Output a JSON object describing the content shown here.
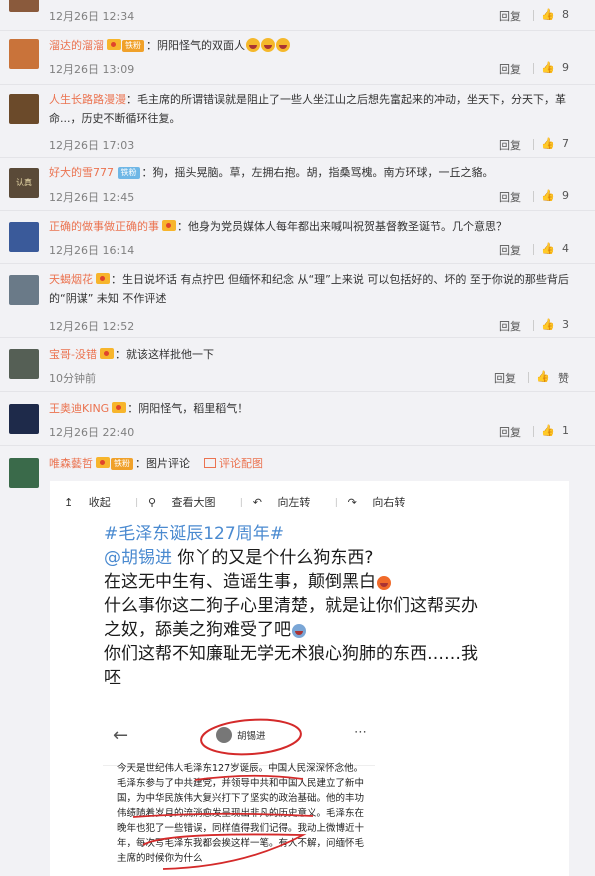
{
  "reply_label": "回复",
  "like_label": "赞",
  "comments": [
    {
      "user": "",
      "text": "",
      "time": "12月26日 12:34",
      "likes": "8",
      "avatar_color": "#8a5a3c"
    },
    {
      "user": "溜达的溜溜",
      "badge": "铁粉",
      "text": "：阴阳怪气的双面人",
      "time": "12月26日 13:09",
      "likes": "9",
      "avatar_color": "#c9733a"
    },
    {
      "user": "人生长路路漫漫",
      "text": "：毛主席的所谓错误就是阻止了一些人坐江山之后想先富起来的冲动，坐天下，分天下，革命...，历史不断循环往复。",
      "time": "12月26日 17:03",
      "likes": "7",
      "avatar_color": "#6b4a2a"
    },
    {
      "user": "好大的雪777",
      "badge": "铁粉",
      "text": "：狗，摇头晃脑。草，左拥右抱。胡，指桑骂槐。南方环球，一丘之貉。",
      "time": "12月26日 12:45",
      "likes": "9",
      "avatar_color": "#5a4a38",
      "avatar_text": "认真"
    },
    {
      "user": "正确的做事做正确的事",
      "text": "：他身为党员媒体人每年都出来喊叫祝贺基督教圣诞节。几个意思？",
      "time": "12月26日 16:14",
      "likes": "4",
      "avatar_color": "#3a5a9a"
    },
    {
      "user": "天蝎烟花",
      "text": "：生日说坏话 有点拧巴 但缅怀和纪念  从“理”上来说  可以包括好的、坏的 至于你说的那些背后的“阴谋”   未知   不作评述",
      "time": "12月26日 12:52",
      "likes": "3",
      "avatar_color": "#6a7a88"
    },
    {
      "user": "宝哥-没错",
      "text": "：就该这样批他一下",
      "time": "10分钟前",
      "likes": "赞",
      "avatar_color": "#555f55"
    },
    {
      "user": "王奥迪KING",
      "text": "：阴阳怪气，稻里稻气！",
      "time": "12月26日 22:40",
      "likes": "1",
      "avatar_color": "#1e2a4a"
    },
    {
      "user": "唯森藝哲",
      "badge": "铁粉",
      "text": "：图片评论",
      "link": "评论配图",
      "avatar_color": "#3a6a4a"
    }
  ],
  "image_panel": {
    "tools": [
      "收起",
      "查看大图",
      "向左转",
      "向右转"
    ],
    "hashtag": "#毛泽东诞辰127周年#",
    "mention": "@胡锡进",
    "lines": [
      " 你丫的又是个什么狗东西?",
      "在这无中生有、造谣生事，颠倒黑白",
      "什么事你这二狗子心里清楚，就是让你们这帮买办",
      "之奴，舔美之狗难受了吧",
      "你们这帮不知廉耻无学无术狼心狗肺的东西……我",
      "呸"
    ],
    "shot_user": "胡锡进",
    "shot_text": "今天是世纪伟人毛泽东127岁诞辰。中国人民深深怀念他。毛泽东参与了中共建党，并领导中共和中国人民建立了新中国，为中华民族伟大复兴打下了坚实的政治基础。他的丰功伟绩随着岁月的流淌愈发呈现出非凡的历史意义。毛泽东在晚年也犯了一些错误，同样值得我们记得。我动上微博近十年，每次写毛泽东我都会挨这样一笔。有人不解，问缅怀毛主席的时候你为什么"
  }
}
